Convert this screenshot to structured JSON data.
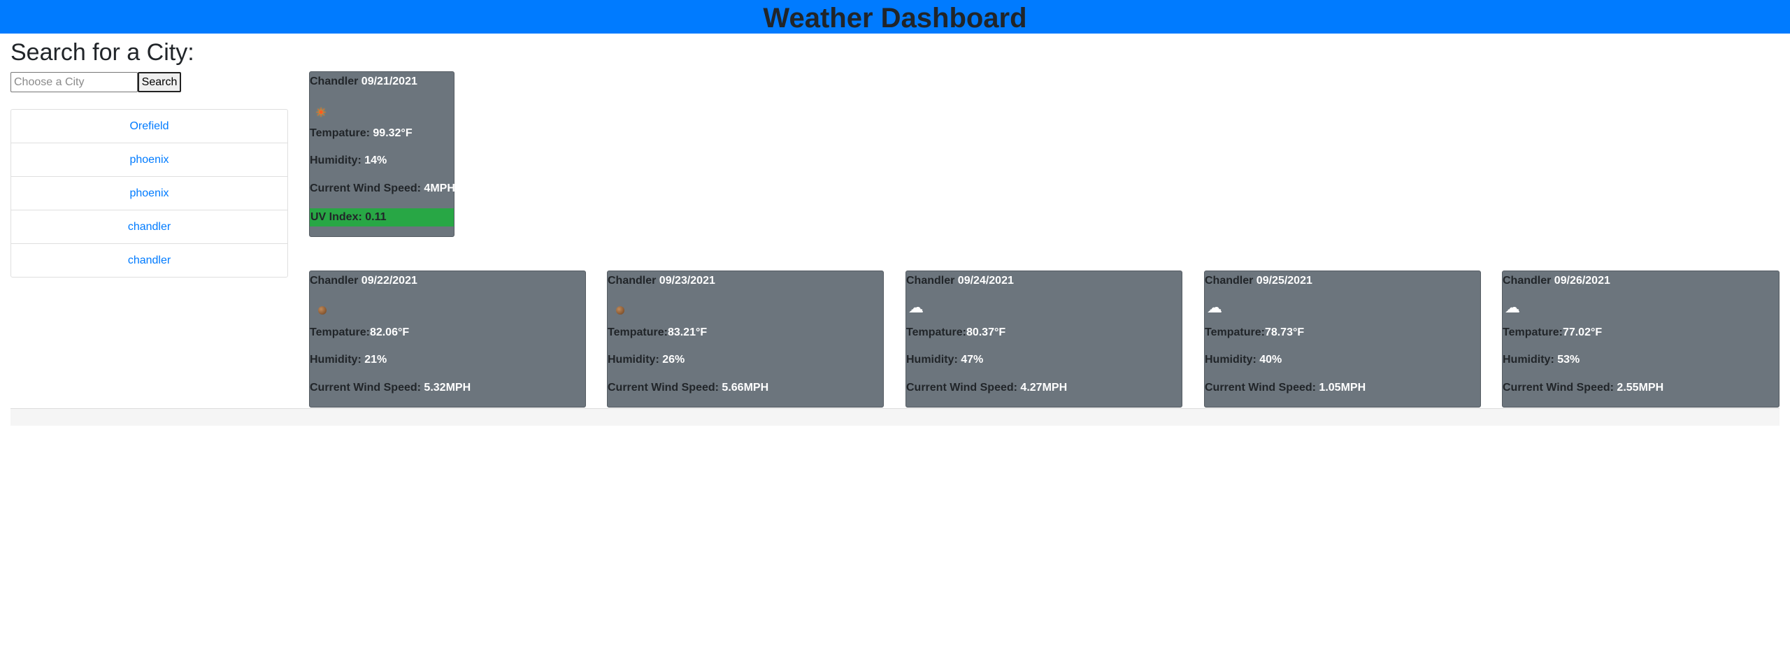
{
  "header": {
    "title": "Weather Dashboard"
  },
  "search": {
    "title": "Search for a City:",
    "placeholder": "Choose a City",
    "button_label": "Search"
  },
  "history": [
    "Orefield",
    "phoenix",
    "phoenix",
    "chandler",
    "chandler"
  ],
  "labels": {
    "temperature": "Tempature:",
    "humidity": "Humidity:",
    "wind": "Current Wind Speed:",
    "uv": "UV Index:"
  },
  "current": {
    "city": "Chandler",
    "date": "09/21/2021",
    "icon": "sun-icon",
    "temperature": "99.32°F",
    "humidity": "14%",
    "wind": "4MPH",
    "uv": "0.11",
    "uv_color": "#28a745"
  },
  "forecast": [
    {
      "city": "Chandler",
      "date": "09/22/2021",
      "icon": "clear-night-icon",
      "temperature": "82.06°F",
      "humidity": "21%",
      "wind": "5.32MPH"
    },
    {
      "city": "Chandler",
      "date": "09/23/2021",
      "icon": "clear-night-icon",
      "temperature": "83.21°F",
      "humidity": "26%",
      "wind": "5.66MPH"
    },
    {
      "city": "Chandler",
      "date": "09/24/2021",
      "icon": "cloud-icon",
      "temperature": "80.37°F",
      "humidity": "47%",
      "wind": "4.27MPH"
    },
    {
      "city": "Chandler",
      "date": "09/25/2021",
      "icon": "cloud-icon",
      "temperature": "78.73°F",
      "humidity": "40%",
      "wind": "1.05MPH"
    },
    {
      "city": "Chandler",
      "date": "09/26/2021",
      "icon": "cloud-icon",
      "temperature": "77.02°F",
      "humidity": "53%",
      "wind": "2.55MPH"
    }
  ],
  "colors": {
    "header": "#007bff",
    "card": "#6c757d",
    "link": "#007bff",
    "uv_good": "#28a745"
  }
}
